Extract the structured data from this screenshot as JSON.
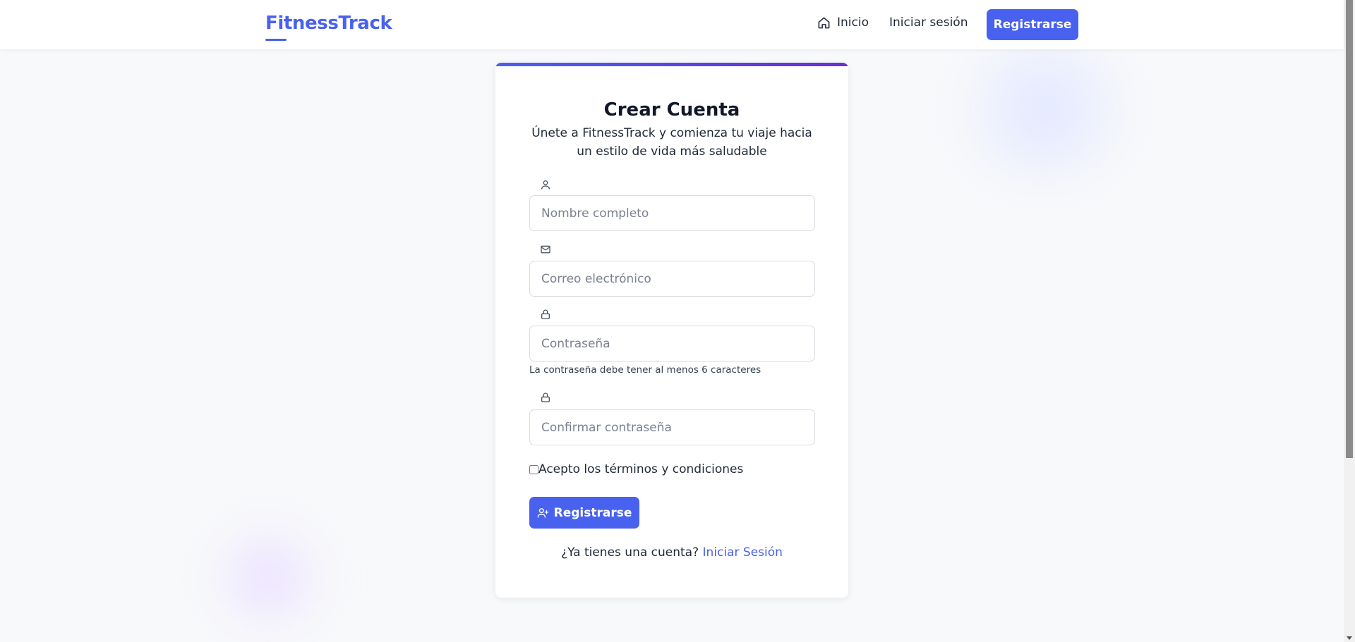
{
  "header": {
    "brand": "FitnessTrack",
    "nav": {
      "home_label": "Inicio",
      "login_label": "Iniciar sesión",
      "register_label": "Registrarse"
    }
  },
  "form": {
    "title": "Crear Cuenta",
    "subtitle": "Únete a FitnessTrack y comienza tu viaje hacia un estilo de vida más saludable",
    "fields": {
      "name": {
        "placeholder": "Nombre completo",
        "value": "",
        "icon": "user-icon"
      },
      "email": {
        "placeholder": "Correo electrónico",
        "value": "",
        "icon": "mail-icon"
      },
      "password": {
        "placeholder": "Contraseña",
        "value": "",
        "icon": "lock-icon"
      },
      "confirm_password": {
        "placeholder": "Confirmar contraseña",
        "value": "",
        "icon": "lock-icon"
      }
    },
    "password_hint": "La contraseña debe tener al menos 6 caracteres",
    "terms_label": "Acepto los términos y condiciones",
    "terms_checked": false,
    "submit_label": "Registrarse",
    "login_prompt": "¿Ya tienes una cuenta?",
    "login_link": "Iniciar Sesión"
  },
  "colors": {
    "accent": "#4861ef",
    "accent_gradient_end": "#6a2fd6",
    "background": "#f8f9fb",
    "card": "#ffffff"
  }
}
